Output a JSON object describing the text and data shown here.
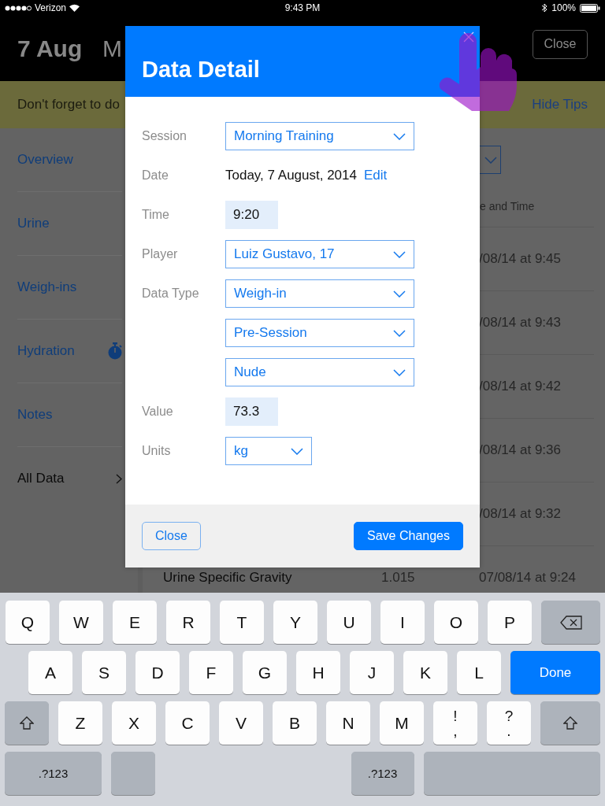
{
  "status_bar": {
    "carrier": "Verizon",
    "time": "9:43 PM",
    "battery": "100%"
  },
  "header": {
    "date": "7 Aug",
    "title": "M",
    "close": "Close"
  },
  "tip_bar": {
    "text": "Don't forget to do",
    "action": "Hide Tips"
  },
  "sidebar": {
    "items": [
      {
        "label": "Overview",
        "selected": false,
        "kind": "plain"
      },
      {
        "label": "Urine",
        "selected": false,
        "kind": "plain"
      },
      {
        "label": "Weigh-ins",
        "selected": false,
        "kind": "plain"
      },
      {
        "label": "Hydration",
        "selected": false,
        "kind": "timer"
      },
      {
        "label": "Notes",
        "selected": false,
        "kind": "plain"
      },
      {
        "label": "All Data",
        "selected": true,
        "kind": "drill"
      }
    ]
  },
  "table": {
    "column": "e and Time",
    "rows": [
      {
        "cells": [
          "/08/14 at 9:45"
        ]
      },
      {
        "cells": [
          "/08/14 at 9:43"
        ]
      },
      {
        "cells": [
          "/08/14 at 9:42"
        ]
      },
      {
        "cells": [
          "/08/14 at 9:36"
        ]
      },
      {
        "cells": [
          "/08/14 at 9:32"
        ]
      },
      {
        "cells": [
          "Urine Specific Gravity",
          "1.015",
          "07/08/14 at 9:24"
        ]
      }
    ]
  },
  "dialog": {
    "title": "Data Detail",
    "fields": [
      {
        "label": "Session",
        "kind": "select",
        "value": "Morning Training"
      },
      {
        "label": "Date",
        "kind": "text",
        "value": "Today, 7 August, 2014",
        "link": "Edit"
      },
      {
        "label": "Time",
        "kind": "input",
        "value": "9:20"
      },
      {
        "label": "Player",
        "kind": "select",
        "value": "Luiz Gustavo, 17"
      },
      {
        "label": "Data Type",
        "kind": "select",
        "value": "Weigh-in"
      },
      {
        "kind": "select",
        "value": "Pre-Session"
      },
      {
        "kind": "select",
        "value": "Nude"
      },
      {
        "label": "Value",
        "kind": "input",
        "value": "73.3"
      },
      {
        "label": "Units",
        "kind": "select-short",
        "value": "kg"
      }
    ],
    "buttons": [
      {
        "label": "Close",
        "kind": "secondary"
      },
      {
        "label": "Save Changes",
        "kind": "primary"
      }
    ]
  },
  "keyboard": {
    "rows": [
      [
        {
          "kind": "letter",
          "label": "Q"
        },
        {
          "kind": "letter",
          "label": "W"
        },
        {
          "kind": "letter",
          "label": "E"
        },
        {
          "kind": "letter",
          "label": "R"
        },
        {
          "kind": "letter",
          "label": "T"
        },
        {
          "kind": "letter",
          "label": "Y"
        },
        {
          "kind": "letter",
          "label": "U"
        },
        {
          "kind": "letter",
          "label": "I"
        },
        {
          "kind": "letter",
          "label": "O"
        },
        {
          "kind": "letter",
          "label": "P"
        },
        {
          "kind": "backspace"
        }
      ],
      [
        {
          "kind": "letter",
          "label": "A"
        },
        {
          "kind": "letter",
          "label": "S"
        },
        {
          "kind": "letter",
          "label": "D"
        },
        {
          "kind": "letter",
          "label": "F"
        },
        {
          "kind": "letter",
          "label": "G"
        },
        {
          "kind": "letter",
          "label": "H"
        },
        {
          "kind": "letter",
          "label": "J"
        },
        {
          "kind": "letter",
          "label": "K"
        },
        {
          "kind": "letter",
          "label": "L"
        },
        {
          "kind": "done",
          "label": "Done"
        }
      ],
      [
        {
          "kind": "shift"
        },
        {
          "kind": "letter",
          "label": "Z"
        },
        {
          "kind": "letter",
          "label": "X"
        },
        {
          "kind": "letter",
          "label": "C"
        },
        {
          "kind": "letter",
          "label": "V"
        },
        {
          "kind": "letter",
          "label": "B"
        },
        {
          "kind": "letter",
          "label": "N"
        },
        {
          "kind": "letter",
          "label": "M"
        },
        {
          "kind": "dual",
          "top": "!",
          "bottom": ","
        },
        {
          "kind": "dual",
          "top": "?",
          "bottom": "."
        },
        {
          "kind": "shift"
        }
      ],
      [
        {
          "kind": "mode",
          "label": ".?123"
        },
        {
          "kind": "blank"
        },
        {
          "kind": "gap"
        },
        {
          "kind": "mode",
          "label": ".?123"
        },
        {
          "kind": "blank"
        }
      ]
    ]
  }
}
